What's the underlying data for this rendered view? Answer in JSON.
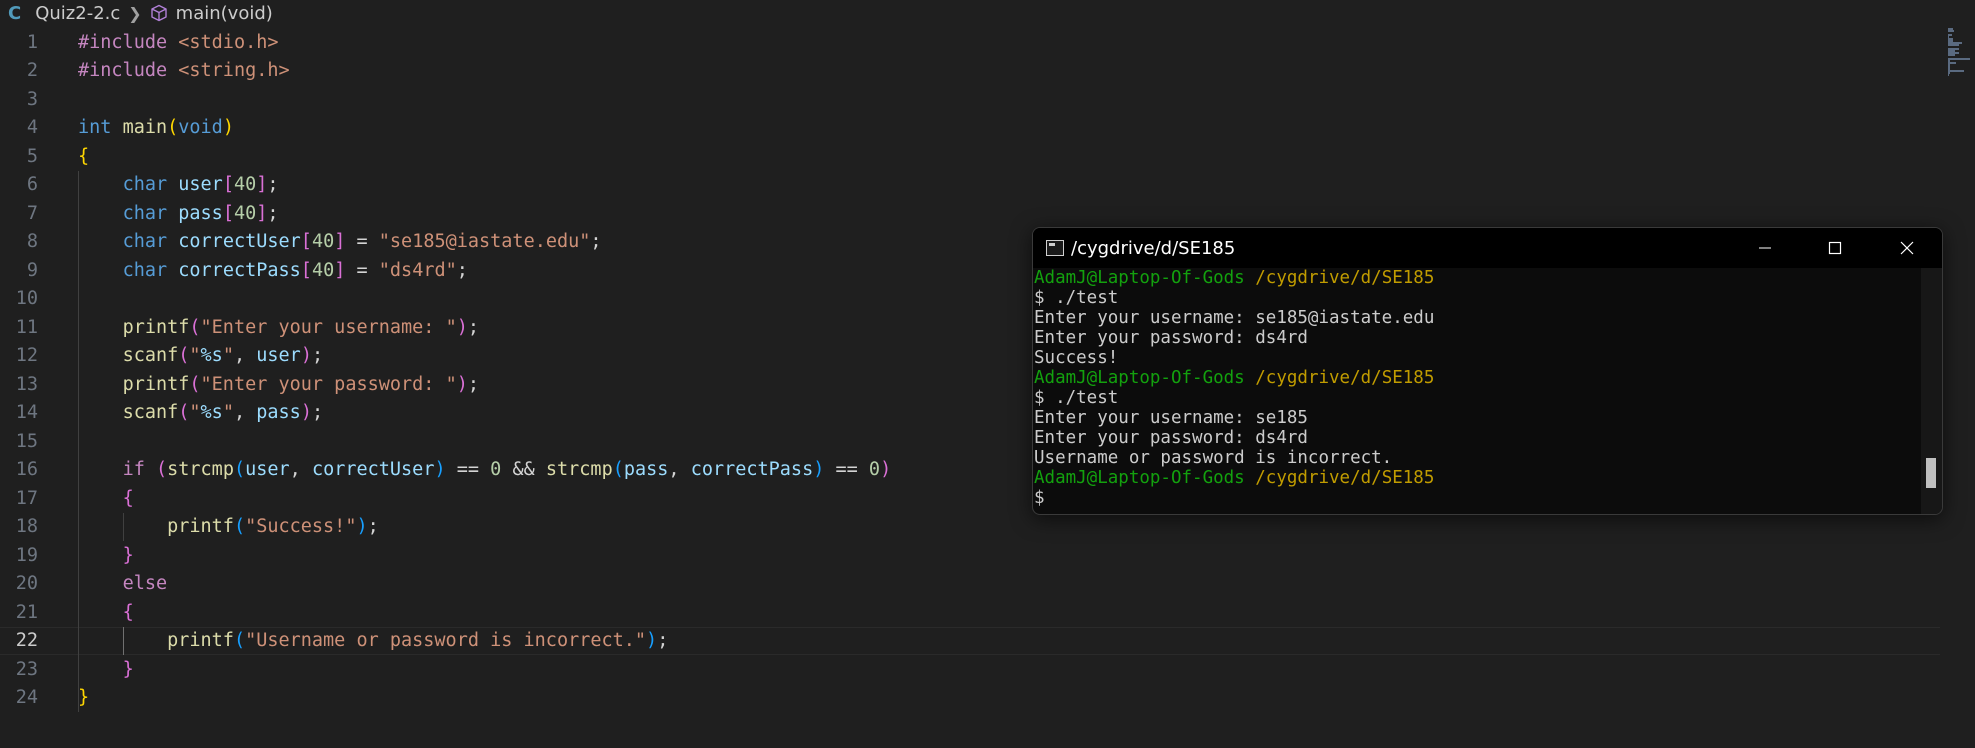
{
  "breadcrumb": {
    "lang_icon": "C",
    "file": "Quiz2-2.c",
    "symbol": "main(void)"
  },
  "editor": {
    "active_line": 22,
    "lines": [
      {
        "n": "1",
        "code": [
          [
            "ctrl",
            "#include"
          ],
          [
            "punc",
            " "
          ],
          [
            "str",
            "<stdio.h>"
          ]
        ]
      },
      {
        "n": "2",
        "code": [
          [
            "ctrl",
            "#include"
          ],
          [
            "punc",
            " "
          ],
          [
            "str",
            "<string.h>"
          ]
        ]
      },
      {
        "n": "3",
        "code": []
      },
      {
        "n": "4",
        "code": [
          [
            "kw",
            "int"
          ],
          [
            "punc",
            " "
          ],
          [
            "fn",
            "main"
          ],
          [
            "br1",
            "("
          ],
          [
            "kw",
            "void"
          ],
          [
            "br1",
            ")"
          ]
        ]
      },
      {
        "n": "5",
        "code": [
          [
            "br1",
            "{"
          ]
        ]
      },
      {
        "n": "6",
        "code": [
          [
            "punc",
            "    "
          ],
          [
            "kw",
            "char"
          ],
          [
            "punc",
            " "
          ],
          [
            "var",
            "user"
          ],
          [
            "br2",
            "["
          ],
          [
            "num",
            "40"
          ],
          [
            "br2",
            "]"
          ],
          [
            "punc",
            ";"
          ]
        ]
      },
      {
        "n": "7",
        "code": [
          [
            "punc",
            "    "
          ],
          [
            "kw",
            "char"
          ],
          [
            "punc",
            " "
          ],
          [
            "var",
            "pass"
          ],
          [
            "br2",
            "["
          ],
          [
            "num",
            "40"
          ],
          [
            "br2",
            "]"
          ],
          [
            "punc",
            ";"
          ]
        ]
      },
      {
        "n": "8",
        "code": [
          [
            "punc",
            "    "
          ],
          [
            "kw",
            "char"
          ],
          [
            "punc",
            " "
          ],
          [
            "var",
            "correctUser"
          ],
          [
            "br2",
            "["
          ],
          [
            "num",
            "40"
          ],
          [
            "br2",
            "]"
          ],
          [
            "punc",
            " = "
          ],
          [
            "str",
            "\"se185@iastate.edu\""
          ],
          [
            "punc",
            ";"
          ]
        ]
      },
      {
        "n": "9",
        "code": [
          [
            "punc",
            "    "
          ],
          [
            "kw",
            "char"
          ],
          [
            "punc",
            " "
          ],
          [
            "var",
            "correctPass"
          ],
          [
            "br2",
            "["
          ],
          [
            "num",
            "40"
          ],
          [
            "br2",
            "]"
          ],
          [
            "punc",
            " = "
          ],
          [
            "str",
            "\"ds4rd\""
          ],
          [
            "punc",
            ";"
          ]
        ]
      },
      {
        "n": "10",
        "code": []
      },
      {
        "n": "11",
        "code": [
          [
            "punc",
            "    "
          ],
          [
            "fn",
            "printf"
          ],
          [
            "br2",
            "("
          ],
          [
            "str",
            "\"Enter your username: \""
          ],
          [
            "br2",
            ")"
          ],
          [
            "punc",
            ";"
          ]
        ]
      },
      {
        "n": "12",
        "code": [
          [
            "punc",
            "    "
          ],
          [
            "fn",
            "scanf"
          ],
          [
            "br2",
            "("
          ],
          [
            "str",
            "\""
          ],
          [
            "var",
            "%s"
          ],
          [
            "str",
            "\""
          ],
          [
            "punc",
            ", "
          ],
          [
            "var",
            "user"
          ],
          [
            "br2",
            ")"
          ],
          [
            "punc",
            ";"
          ]
        ]
      },
      {
        "n": "13",
        "code": [
          [
            "punc",
            "    "
          ],
          [
            "fn",
            "printf"
          ],
          [
            "br2",
            "("
          ],
          [
            "str",
            "\"Enter your password: \""
          ],
          [
            "br2",
            ")"
          ],
          [
            "punc",
            ";"
          ]
        ]
      },
      {
        "n": "14",
        "code": [
          [
            "punc",
            "    "
          ],
          [
            "fn",
            "scanf"
          ],
          [
            "br2",
            "("
          ],
          [
            "str",
            "\""
          ],
          [
            "var",
            "%s"
          ],
          [
            "str",
            "\""
          ],
          [
            "punc",
            ", "
          ],
          [
            "var",
            "pass"
          ],
          [
            "br2",
            ")"
          ],
          [
            "punc",
            ";"
          ]
        ]
      },
      {
        "n": "15",
        "code": []
      },
      {
        "n": "16",
        "code": [
          [
            "punc",
            "    "
          ],
          [
            "ctrl",
            "if"
          ],
          [
            "punc",
            " "
          ],
          [
            "br2",
            "("
          ],
          [
            "fn",
            "strcmp"
          ],
          [
            "br3",
            "("
          ],
          [
            "var",
            "user"
          ],
          [
            "punc",
            ", "
          ],
          [
            "var",
            "correctUser"
          ],
          [
            "br3",
            ")"
          ],
          [
            "punc",
            " == "
          ],
          [
            "num",
            "0"
          ],
          [
            "punc",
            " && "
          ],
          [
            "fn",
            "strcmp"
          ],
          [
            "br3",
            "("
          ],
          [
            "var",
            "pass"
          ],
          [
            "punc",
            ", "
          ],
          [
            "var",
            "correctPass"
          ],
          [
            "br3",
            ")"
          ],
          [
            "punc",
            " == "
          ],
          [
            "num",
            "0"
          ],
          [
            "br2",
            ")"
          ]
        ]
      },
      {
        "n": "17",
        "code": [
          [
            "punc",
            "    "
          ],
          [
            "br2",
            "{"
          ]
        ]
      },
      {
        "n": "18",
        "code": [
          [
            "punc",
            "        "
          ],
          [
            "fn",
            "printf"
          ],
          [
            "br3",
            "("
          ],
          [
            "str",
            "\"Success!\""
          ],
          [
            "br3",
            ")"
          ],
          [
            "punc",
            ";"
          ]
        ]
      },
      {
        "n": "19",
        "code": [
          [
            "punc",
            "    "
          ],
          [
            "br2",
            "}"
          ]
        ]
      },
      {
        "n": "20",
        "code": [
          [
            "punc",
            "    "
          ],
          [
            "ctrl",
            "else"
          ]
        ]
      },
      {
        "n": "21",
        "code": [
          [
            "punc",
            "    "
          ],
          [
            "br2",
            "{"
          ]
        ]
      },
      {
        "n": "22",
        "code": [
          [
            "punc",
            "        "
          ],
          [
            "fn",
            "printf"
          ],
          [
            "br3",
            "("
          ],
          [
            "str",
            "\"Username or password is incorrect.\""
          ],
          [
            "br3",
            ")"
          ],
          [
            "punc",
            ";"
          ]
        ]
      },
      {
        "n": "23",
        "code": [
          [
            "punc",
            "    "
          ],
          [
            "br2",
            "}"
          ]
        ]
      },
      {
        "n": "24",
        "code": [
          [
            "br1",
            "}"
          ]
        ]
      }
    ]
  },
  "terminal": {
    "title": "/cygdrive/d/SE185",
    "buttons": {
      "minimize": "minimize-icon",
      "maximize": "maximize-icon",
      "close": "close-icon"
    },
    "lines": [
      [
        [
          "green",
          "AdamJ@Laptop-Of-Gods"
        ],
        [
          "plain",
          " "
        ],
        [
          "yellow",
          "/cygdrive/d/SE185"
        ]
      ],
      [
        [
          "plain",
          "$ ./test"
        ]
      ],
      [
        [
          "plain",
          "Enter your username: se185@iastate.edu"
        ]
      ],
      [
        [
          "plain",
          "Enter your password: ds4rd"
        ]
      ],
      [
        [
          "plain",
          "Success!"
        ]
      ],
      [
        [
          "green",
          "AdamJ@Laptop-Of-Gods"
        ],
        [
          "plain",
          " "
        ],
        [
          "yellow",
          "/cygdrive/d/SE185"
        ]
      ],
      [
        [
          "plain",
          "$ ./test"
        ]
      ],
      [
        [
          "plain",
          "Enter your username: se185"
        ]
      ],
      [
        [
          "plain",
          "Enter your password: ds4rd"
        ]
      ],
      [
        [
          "plain",
          "Username or password is incorrect."
        ]
      ],
      [
        [
          "green",
          "AdamJ@Laptop-Of-Gods"
        ],
        [
          "plain",
          " "
        ],
        [
          "yellow",
          "/cygdrive/d/SE185"
        ]
      ],
      [
        [
          "plain",
          "$"
        ]
      ]
    ],
    "scroll_position": 0.88
  },
  "colors": {
    "editor_bg": "#1f1f1f",
    "terminal_bg": "#0c0c0c",
    "prompt_user": "#13a10e",
    "prompt_path": "#c19c00"
  }
}
